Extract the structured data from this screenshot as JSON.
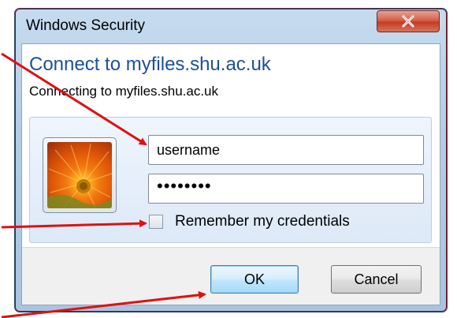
{
  "window": {
    "title": "Windows Security",
    "close_icon": "close-x-icon"
  },
  "header": {
    "connect_title": "Connect to myfiles.shu.ac.uk",
    "connect_subtitle": "Connecting to myfiles.shu.ac.uk"
  },
  "credentials": {
    "avatar_icon": "flower-user-tile-icon",
    "username_value": "username",
    "password_value": "••••••••",
    "remember_label": "Remember my credentials",
    "remember_checked": false
  },
  "buttons": {
    "ok_label": "OK",
    "cancel_label": "Cancel"
  },
  "annotations": {
    "arrow_color": "#e01010",
    "arrow_targets": [
      "username-field",
      "remember-checkbox",
      "ok-button"
    ]
  },
  "colors": {
    "title_blue": "#1c4f9c",
    "close_red": "#c23d25",
    "frame_border": "#8c0f12"
  }
}
